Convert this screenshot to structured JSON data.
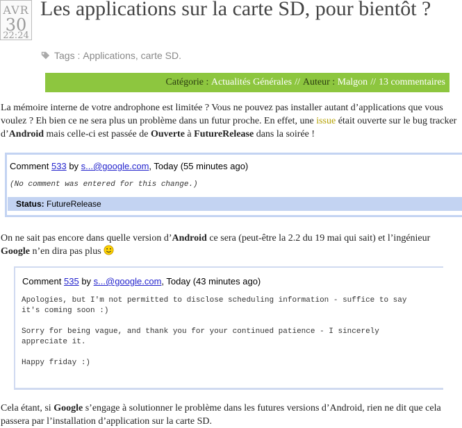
{
  "post": {
    "date": {
      "month": "AVR",
      "day": "30",
      "time": "22:24"
    },
    "title": "Les applications sur la carte SD, pour bientôt ?",
    "tags_label": "Tags :",
    "tags": [
      "Applications",
      "carte SD"
    ],
    "tags_end": ".",
    "meta": {
      "category_label": "Catégorie :",
      "category": "Actualités Générales",
      "separator": "//",
      "author_label": "Auteur :",
      "author": "Malgon",
      "comments": "13 commentaires"
    },
    "paragraphs": {
      "p1": {
        "t1": "La mémoire interne de votre androphone est limitée ? Vous ne pouvez pas installer autant d’applications que vous voulez ? Eh bien ce ne sera plus un problème dans un futur proche. En effet, une ",
        "link": "issue",
        "t2": " était ouverte sur le bug tracker d’",
        "b1": "Android",
        "t3": " mais celle-ci est passée de ",
        "b2": "Ouverte",
        "t4": " à ",
        "b3": "FutureRelease",
        "t5": " dans la soirée !"
      },
      "p2": {
        "t1": "On ne sait pas encore dans quelle version d’",
        "b1": "Android",
        "t2": " ce sera (peut-être la 2.2 du 19 mai qui sait) et l’ingénieur ",
        "b2": "Google",
        "t3": " n’en dira pas plus "
      },
      "p3": {
        "t1": "Cela étant, si ",
        "b1": "Google",
        "t2": " s’engage à solutionner le problème dans les futures versions d’Android, rien ne dit que cela passera par l’installation d’application sur la carte SD."
      }
    }
  },
  "comment1": {
    "prefix": "Comment",
    "number": "533",
    "by": "by",
    "author": "s...@google.com",
    "when": ", Today (55 minutes ago)",
    "body": "(No comment was entered for this change.)",
    "status_label": "Status:",
    "status_value": "FutureRelease"
  },
  "comment2": {
    "prefix": "Comment",
    "number": "535",
    "by": "by",
    "author": "s...@google.com",
    "when": ", Today (43 minutes ago)",
    "line1": "Apologies, but I'm not permitted to disclose scheduling information - suffice to say",
    "line2": "it's coming soon :)",
    "line3": "Sorry for being vague, and thank you for your continued patience - I sincerely",
    "line4": "appreciate it.",
    "line5": "Happy friday :)"
  },
  "icons": {
    "tag": "tag-icon",
    "smiley": "smiley-icon"
  },
  "colors": {
    "category_bar": "#8dc63f",
    "comment_border": "#c3d3f2",
    "link": "#b3a000",
    "comment_link": "#2222cc"
  }
}
